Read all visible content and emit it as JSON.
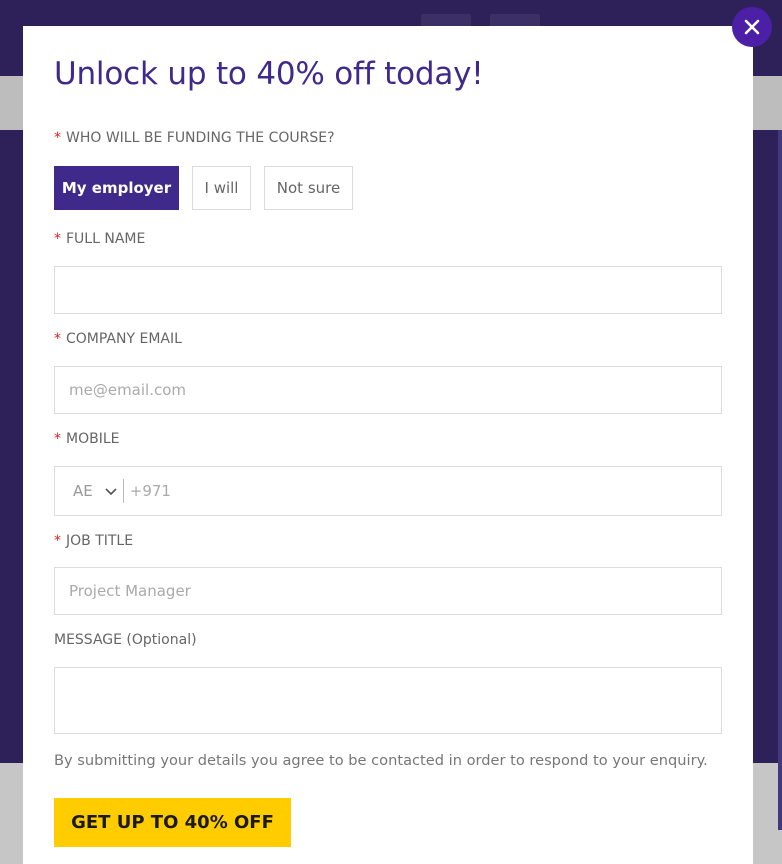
{
  "modal": {
    "title": "Unlock up to 40% off today!",
    "close_label": "×"
  },
  "form": {
    "required_marker": "*",
    "funding": {
      "label": "WHO WILL BE FUNDING THE COURSE?",
      "options": [
        "My employer",
        "I will",
        "Not sure"
      ],
      "selected": "My employer"
    },
    "full_name": {
      "label": "FULL NAME",
      "value": "",
      "placeholder": ""
    },
    "email": {
      "label": "COMPANY EMAIL",
      "value": "",
      "placeholder": "me@email.com"
    },
    "mobile": {
      "label": "MOBILE",
      "country": "AE",
      "dial_code": "+971",
      "value": ""
    },
    "job_title": {
      "label": "JOB TITLE",
      "value": "",
      "placeholder": "Project Manager"
    },
    "message": {
      "label": "MESSAGE (Optional)",
      "value": ""
    },
    "consent": "By submitting your details you agree to be contacted in order to respond to your enquiry.",
    "submit_label": "GET UP TO 40% OFF"
  },
  "colors": {
    "brand_purple": "#3f2a8c",
    "close_purple": "#4b1fa6",
    "cta_yellow": "#ffcc00",
    "required_red": "#e02020"
  }
}
